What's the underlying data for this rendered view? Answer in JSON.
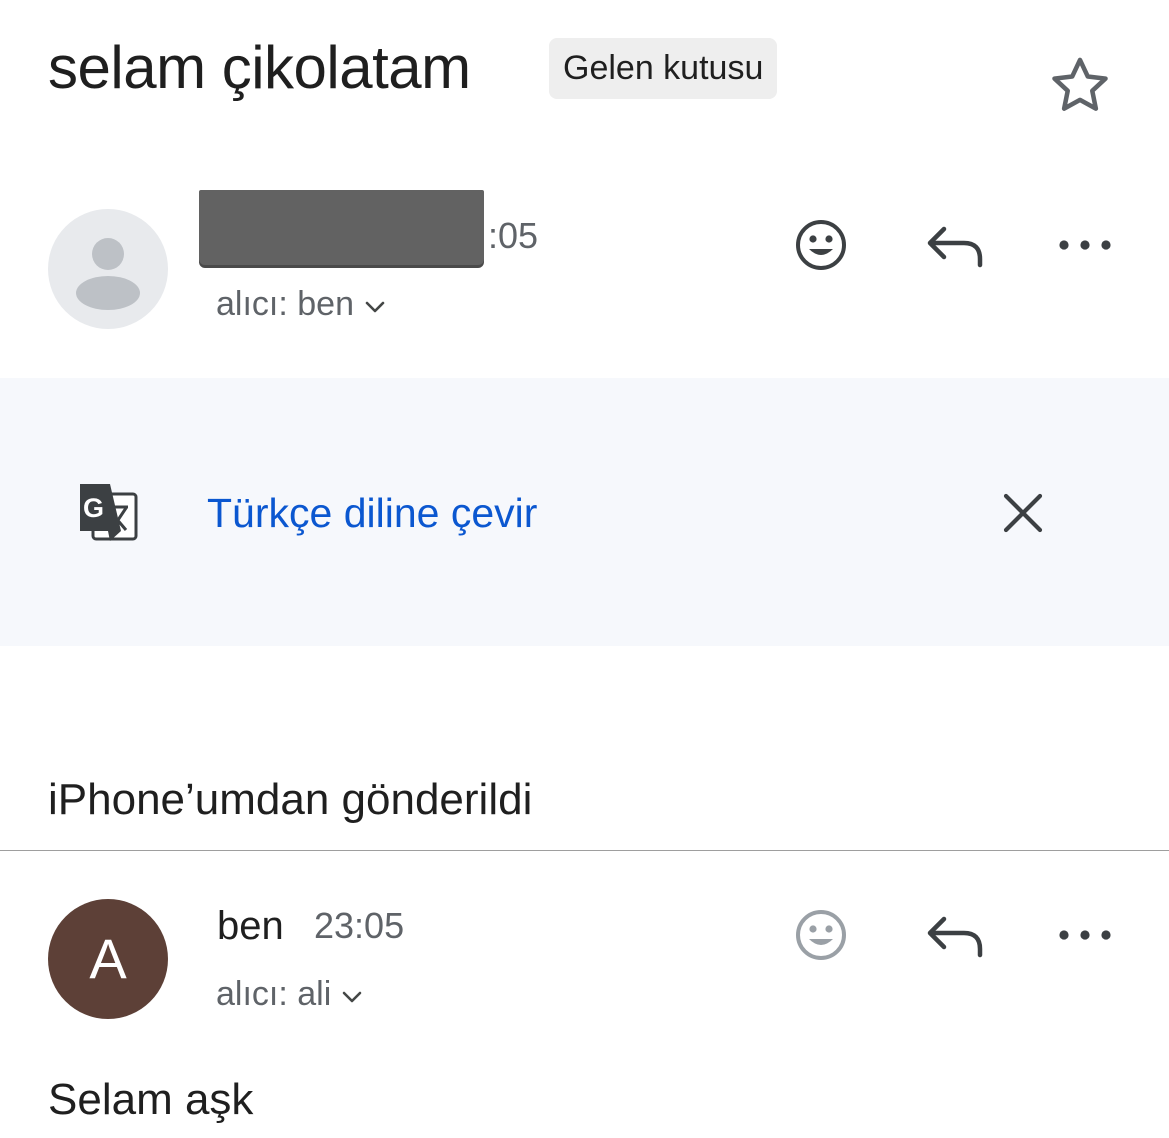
{
  "thread": {
    "subject": "selam çikolatam",
    "label": "Gelen kutusu"
  },
  "message1": {
    "time_suffix": ":05",
    "to_line": "alıcı: ben",
    "sender_redacted": true
  },
  "translate": {
    "link": "Türkçe diline çevir"
  },
  "signature": "iPhone’umdan gönderildi",
  "message2": {
    "avatar_letter": "A",
    "avatar_color": "#5d4037",
    "sender": "ben",
    "time": "23:05",
    "to_line": "alıcı: ali",
    "body": "Selam aşk"
  },
  "colors": {
    "link_blue": "#0b57d0",
    "translate_bg": "#f6f8fc",
    "chip_bg": "#eeeeee"
  },
  "icons": [
    "star-icon",
    "person-icon",
    "emoji-icon",
    "reply-icon",
    "more-icon",
    "google-translate-icon",
    "close-icon",
    "chevron-down-icon"
  ]
}
